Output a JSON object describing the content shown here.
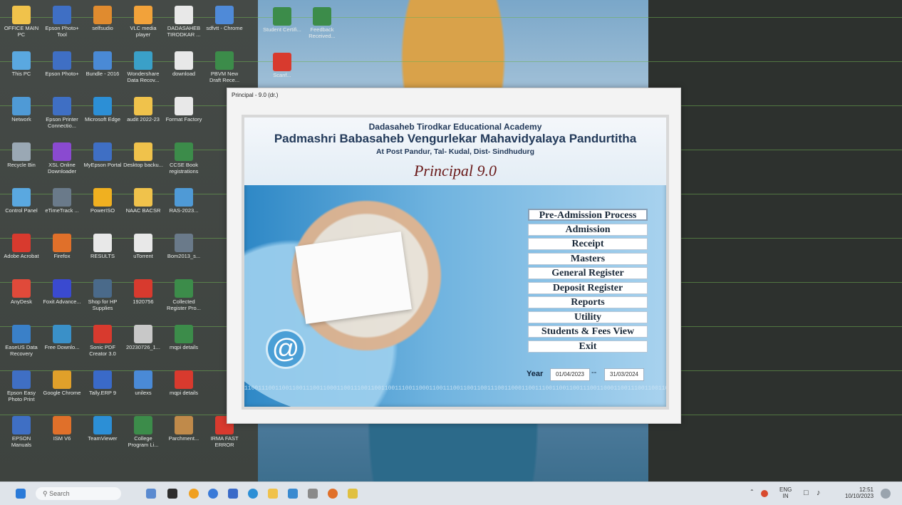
{
  "desktop": {
    "icons": [
      {
        "label": "OFFICE MAIN PC",
        "color": "#f0c24b"
      },
      {
        "label": "Epson Photo+ Tool",
        "color": "#3f6fc4"
      },
      {
        "label": "selfsudio",
        "color": "#e08b2f"
      },
      {
        "label": "VLC media player",
        "color": "#f2a23a"
      },
      {
        "label": "DADASAHEB TIRODKAR ...",
        "color": "#e8e8e8"
      },
      {
        "label": "sdfvtt - Chrome",
        "color": "#4f8ad8"
      },
      {
        "label": "This PC",
        "color": "#5aa8e0"
      },
      {
        "label": "Epson Photo+",
        "color": "#3f6fc4"
      },
      {
        "label": "Bundle - 2016",
        "color": "#4a8ad6"
      },
      {
        "label": "Wondershare Data Recov...",
        "color": "#3aa0c8"
      },
      {
        "label": "download",
        "color": "#e8e8e8"
      },
      {
        "label": "PBVM New Draft Rece...",
        "color": "#3c8c4a"
      },
      {
        "label": "Network",
        "color": "#4f9ad6"
      },
      {
        "label": "Epson Printer Connectio...",
        "color": "#3f6fc4"
      },
      {
        "label": "Microsoft Edge",
        "color": "#2c8fd6"
      },
      {
        "label": "audit 2022-23",
        "color": "#f0c24b"
      },
      {
        "label": "Format Factory",
        "color": "#e8e8e8"
      },
      {
        "label": "Recycle Bin",
        "color": "#9aa8b4"
      },
      {
        "label": "XSL Online Downloader",
        "color": "#8a4ad0"
      },
      {
        "label": "MyEpson Portal",
        "color": "#3f6fc4"
      },
      {
        "label": "Desktop backu...",
        "color": "#f0c24b"
      },
      {
        "label": "CCSE Book registrations",
        "color": "#3c8c4a"
      },
      {
        "label": "Control Panel",
        "color": "#5aa8e0"
      },
      {
        "label": "eTimeTrack ...",
        "color": "#6a7a8a"
      },
      {
        "label": "PowerISO",
        "color": "#f0b020"
      },
      {
        "label": "NAAC BACSR",
        "color": "#f0c24b"
      },
      {
        "label": "RAS-2023...",
        "color": "#4f9ad6"
      },
      {
        "label": "Adobe Acrobat",
        "color": "#d83a2e"
      },
      {
        "label": "Firefox",
        "color": "#e0702a"
      },
      {
        "label": "RESULTS",
        "color": "#e8e8e8"
      },
      {
        "label": "uTorrent",
        "color": "#e8e8e8"
      },
      {
        "label": "Bom2013_s...",
        "color": "#6a7a8a"
      },
      {
        "label": "AnyDesk",
        "color": "#e04a3a"
      },
      {
        "label": "Foxit Advance...",
        "color": "#3a4ad0"
      },
      {
        "label": "Shop for HP Supplies",
        "color": "#4a6a8a"
      },
      {
        "label": "1920756",
        "color": "#d83a2e"
      },
      {
        "label": "Collected Register Pro...",
        "color": "#3c8c4a"
      },
      {
        "label": "EaseUS Data Recovery",
        "color": "#3a80c8"
      },
      {
        "label": "Free Downlo...",
        "color": "#3a90c8"
      },
      {
        "label": "Sonic PDF Creator 3.0",
        "color": "#d83a2e"
      },
      {
        "label": "20230726_1...",
        "color": "#c8c8c8"
      },
      {
        "label": "mqpi details",
        "color": "#3c8c4a"
      },
      {
        "label": "Epson Easy Photo Print",
        "color": "#3f6fc4"
      },
      {
        "label": "Google Chrome",
        "color": "#e0a02a"
      },
      {
        "label": "Tally.ERP 9",
        "color": "#3a6ac8"
      },
      {
        "label": "unilexs",
        "color": "#4a8ad6"
      },
      {
        "label": "mqpi details",
        "color": "#d83a2e"
      },
      {
        "label": "EPSON Manuals",
        "color": "#3f6fc4"
      },
      {
        "label": "ISM V6",
        "color": "#e0702a"
      },
      {
        "label": "TeamViewer",
        "color": "#2c8fd6"
      },
      {
        "label": "College Program Li...",
        "color": "#3c8c4a"
      },
      {
        "label": "Parchment...",
        "color": "#c08a4a"
      },
      {
        "label": "IRMA FAST ERROR",
        "color": "#d83a2e"
      }
    ],
    "wallpaper_icons": [
      {
        "label": "Student Certifi...",
        "color": "#3c8c4a"
      },
      {
        "label": "Feedback Received...",
        "color": "#3c8c4a"
      },
      {
        "label": "Scanf...",
        "color": "#d83a2e"
      }
    ]
  },
  "window": {
    "title": "Principal - 9.0 (dr.)",
    "org": "Dadasaheb Tirodkar Educational Academy",
    "college": "Padmashri Babasaheb Vengurlekar Mahavidyalaya Pandurtitha",
    "address": "At Post Pandur, Tal- Kudal, Dist- Sindhudurg",
    "app_name": "Principal 9.0",
    "menu": {
      "pre_admission": "Pre-Admission Process",
      "admission": "Admission",
      "receipt": "Receipt",
      "masters": "Masters",
      "general_register": "General Register",
      "deposit_register": "Deposit Register",
      "reports": "Reports",
      "utility": "Utility",
      "students_fees": "Students & Fees View",
      "exit": "Exit"
    },
    "year_label": "Year",
    "year_from": "01/04/2023",
    "year_to": "31/03/2024",
    "year_sep": "--",
    "binary_text": "1100111001100110011100110001100111001100110011100110001100111001100110011100110001100111001100110011100110001100111001100110011100110001100111001100"
  },
  "taskbar": {
    "search_placeholder": "Search",
    "lang": "ENG",
    "region": "IN",
    "time": "12:51",
    "date": "10/10/2023"
  }
}
